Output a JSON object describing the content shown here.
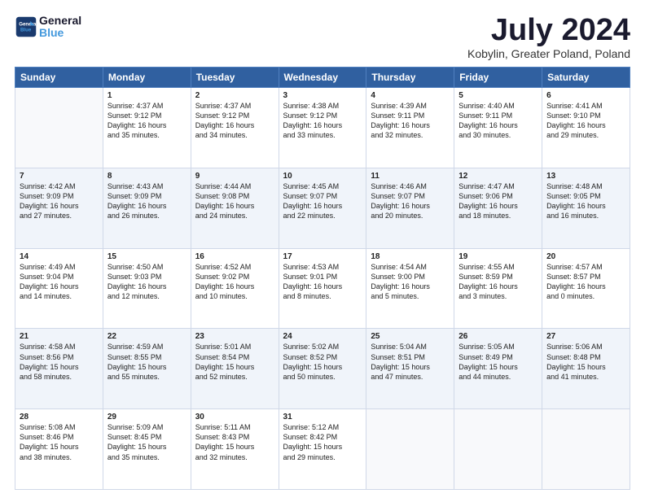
{
  "header": {
    "logo_line1": "General",
    "logo_line2": "Blue",
    "title": "July 2024",
    "subtitle": "Kobylin, Greater Poland, Poland"
  },
  "days_of_week": [
    "Sunday",
    "Monday",
    "Tuesday",
    "Wednesday",
    "Thursday",
    "Friday",
    "Saturday"
  ],
  "weeks": [
    [
      {
        "day": "",
        "info": ""
      },
      {
        "day": "1",
        "info": "Sunrise: 4:37 AM\nSunset: 9:12 PM\nDaylight: 16 hours\nand 35 minutes."
      },
      {
        "day": "2",
        "info": "Sunrise: 4:37 AM\nSunset: 9:12 PM\nDaylight: 16 hours\nand 34 minutes."
      },
      {
        "day": "3",
        "info": "Sunrise: 4:38 AM\nSunset: 9:12 PM\nDaylight: 16 hours\nand 33 minutes."
      },
      {
        "day": "4",
        "info": "Sunrise: 4:39 AM\nSunset: 9:11 PM\nDaylight: 16 hours\nand 32 minutes."
      },
      {
        "day": "5",
        "info": "Sunrise: 4:40 AM\nSunset: 9:11 PM\nDaylight: 16 hours\nand 30 minutes."
      },
      {
        "day": "6",
        "info": "Sunrise: 4:41 AM\nSunset: 9:10 PM\nDaylight: 16 hours\nand 29 minutes."
      }
    ],
    [
      {
        "day": "7",
        "info": "Sunrise: 4:42 AM\nSunset: 9:09 PM\nDaylight: 16 hours\nand 27 minutes."
      },
      {
        "day": "8",
        "info": "Sunrise: 4:43 AM\nSunset: 9:09 PM\nDaylight: 16 hours\nand 26 minutes."
      },
      {
        "day": "9",
        "info": "Sunrise: 4:44 AM\nSunset: 9:08 PM\nDaylight: 16 hours\nand 24 minutes."
      },
      {
        "day": "10",
        "info": "Sunrise: 4:45 AM\nSunset: 9:07 PM\nDaylight: 16 hours\nand 22 minutes."
      },
      {
        "day": "11",
        "info": "Sunrise: 4:46 AM\nSunset: 9:07 PM\nDaylight: 16 hours\nand 20 minutes."
      },
      {
        "day": "12",
        "info": "Sunrise: 4:47 AM\nSunset: 9:06 PM\nDaylight: 16 hours\nand 18 minutes."
      },
      {
        "day": "13",
        "info": "Sunrise: 4:48 AM\nSunset: 9:05 PM\nDaylight: 16 hours\nand 16 minutes."
      }
    ],
    [
      {
        "day": "14",
        "info": "Sunrise: 4:49 AM\nSunset: 9:04 PM\nDaylight: 16 hours\nand 14 minutes."
      },
      {
        "day": "15",
        "info": "Sunrise: 4:50 AM\nSunset: 9:03 PM\nDaylight: 16 hours\nand 12 minutes."
      },
      {
        "day": "16",
        "info": "Sunrise: 4:52 AM\nSunset: 9:02 PM\nDaylight: 16 hours\nand 10 minutes."
      },
      {
        "day": "17",
        "info": "Sunrise: 4:53 AM\nSunset: 9:01 PM\nDaylight: 16 hours\nand 8 minutes."
      },
      {
        "day": "18",
        "info": "Sunrise: 4:54 AM\nSunset: 9:00 PM\nDaylight: 16 hours\nand 5 minutes."
      },
      {
        "day": "19",
        "info": "Sunrise: 4:55 AM\nSunset: 8:59 PM\nDaylight: 16 hours\nand 3 minutes."
      },
      {
        "day": "20",
        "info": "Sunrise: 4:57 AM\nSunset: 8:57 PM\nDaylight: 16 hours\nand 0 minutes."
      }
    ],
    [
      {
        "day": "21",
        "info": "Sunrise: 4:58 AM\nSunset: 8:56 PM\nDaylight: 15 hours\nand 58 minutes."
      },
      {
        "day": "22",
        "info": "Sunrise: 4:59 AM\nSunset: 8:55 PM\nDaylight: 15 hours\nand 55 minutes."
      },
      {
        "day": "23",
        "info": "Sunrise: 5:01 AM\nSunset: 8:54 PM\nDaylight: 15 hours\nand 52 minutes."
      },
      {
        "day": "24",
        "info": "Sunrise: 5:02 AM\nSunset: 8:52 PM\nDaylight: 15 hours\nand 50 minutes."
      },
      {
        "day": "25",
        "info": "Sunrise: 5:04 AM\nSunset: 8:51 PM\nDaylight: 15 hours\nand 47 minutes."
      },
      {
        "day": "26",
        "info": "Sunrise: 5:05 AM\nSunset: 8:49 PM\nDaylight: 15 hours\nand 44 minutes."
      },
      {
        "day": "27",
        "info": "Sunrise: 5:06 AM\nSunset: 8:48 PM\nDaylight: 15 hours\nand 41 minutes."
      }
    ],
    [
      {
        "day": "28",
        "info": "Sunrise: 5:08 AM\nSunset: 8:46 PM\nDaylight: 15 hours\nand 38 minutes."
      },
      {
        "day": "29",
        "info": "Sunrise: 5:09 AM\nSunset: 8:45 PM\nDaylight: 15 hours\nand 35 minutes."
      },
      {
        "day": "30",
        "info": "Sunrise: 5:11 AM\nSunset: 8:43 PM\nDaylight: 15 hours\nand 32 minutes."
      },
      {
        "day": "31",
        "info": "Sunrise: 5:12 AM\nSunset: 8:42 PM\nDaylight: 15 hours\nand 29 minutes."
      },
      {
        "day": "",
        "info": ""
      },
      {
        "day": "",
        "info": ""
      },
      {
        "day": "",
        "info": ""
      }
    ]
  ]
}
